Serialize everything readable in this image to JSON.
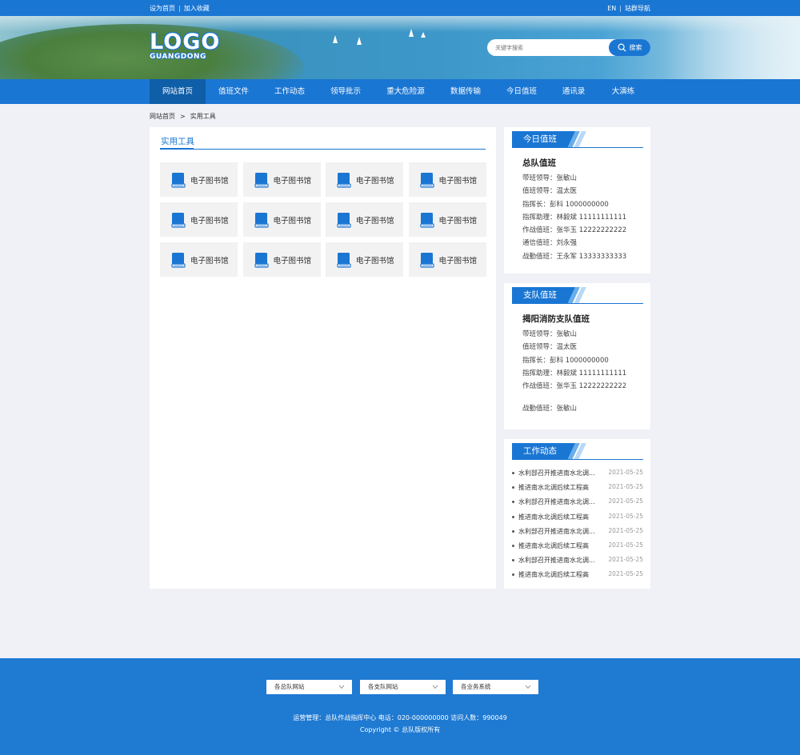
{
  "topbar": {
    "set_home": "设为首页",
    "bookmark": "加入收藏",
    "lang": "EN",
    "site_nav": "站群导航",
    "divider": "|"
  },
  "header": {
    "logo_main": "LOGO",
    "logo_sub": "GUANGDONG",
    "search_placeholder": "关键字搜索",
    "search_button": "搜索"
  },
  "nav": {
    "items": [
      {
        "label": "网站首页",
        "active": true
      },
      {
        "label": "值班文件"
      },
      {
        "label": "工作动态"
      },
      {
        "label": "领导批示"
      },
      {
        "label": "重大危险源"
      },
      {
        "label": "数据传输"
      },
      {
        "label": "今日值班"
      },
      {
        "label": "通讯录"
      },
      {
        "label": "大演练"
      }
    ]
  },
  "breadcrumb": {
    "home": "网站首页",
    "arrow": ">",
    "current": "实用工具"
  },
  "main": {
    "title": "实用工具",
    "tiles": [
      "电子图书馆",
      "电子图书馆",
      "电子图书馆",
      "电子图书馆",
      "电子图书馆",
      "电子图书馆",
      "电子图书馆",
      "电子图书馆",
      "电子图书馆",
      "电子图书馆",
      "电子图书馆",
      "电子图书馆"
    ]
  },
  "today_duty": {
    "title": "今日值班",
    "subtitle": "总队值班",
    "rows": [
      "带班领导：张敏山",
      "值班领导：温太医",
      "指挥长：彭科  1000000000",
      "指挥助理：林毅斌  11111111111",
      "作战值班：张华玉  12222222222",
      "通信值班：刘永强",
      "战勤值班：王永军  13333333333"
    ]
  },
  "branch_duty": {
    "title": "支队值班",
    "subtitle": "揭阳消防支队值班",
    "rows": [
      "带班领导：张敏山",
      "值班领导：温太医",
      "指挥长：彭科  1000000000",
      "指挥助理：林毅斌  11111111111",
      "作战值班：张华玉  12222222222",
      "战勤值班：张敏山"
    ]
  },
  "work_news": {
    "title": "工作动态",
    "items": [
      {
        "title": "水利部召开推进南水北调...",
        "date": "2021-05-25"
      },
      {
        "title": "推进南水北调后续工程高",
        "date": "2021-05-25"
      },
      {
        "title": "水利部召开推进南水北调...",
        "date": "2021-05-25"
      },
      {
        "title": "推进南水北调后续工程高",
        "date": "2021-05-25"
      },
      {
        "title": "水利部召开推进南水北调...",
        "date": "2021-05-25"
      },
      {
        "title": "推进南水北调后续工程高",
        "date": "2021-05-25"
      },
      {
        "title": "水利部召开推进南水北调...",
        "date": "2021-05-25"
      },
      {
        "title": "推进南水北调后续工程高",
        "date": "2021-05-25"
      }
    ]
  },
  "footer": {
    "selects": [
      "各总队网站",
      "各支队网站",
      "各业务系统"
    ],
    "info": "运营管理：总队作战指挥中心   电话：020-000000000   访问人数：990049",
    "copyright": "Copyright © 总队版权所有"
  },
  "colors": {
    "primary": "#1a76d3",
    "nav_active": "#0f5ea8",
    "page_bg": "#f0f1f6",
    "footer_bg": "#1f7ad2"
  }
}
